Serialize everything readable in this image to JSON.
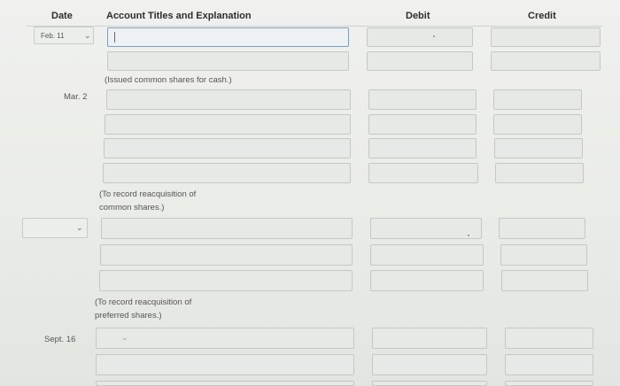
{
  "headers": {
    "date": "Date",
    "account": "Account Titles and Explanation",
    "debit": "Debit",
    "credit": "Credit"
  },
  "entries": [
    {
      "date": "Feb. 11",
      "note": "(Issued common shares for cash.)"
    },
    {
      "date": "Mar. 2",
      "note_line1": "(To record reacquisition of",
      "note_line2": "common shares.)"
    },
    {
      "date": "",
      "note_line1": "(To record reacquisition of",
      "note_line2": "preferred shares.)"
    },
    {
      "date": "Sept. 16"
    }
  ],
  "icons": {
    "dropdown": "chevron-down-icon"
  }
}
